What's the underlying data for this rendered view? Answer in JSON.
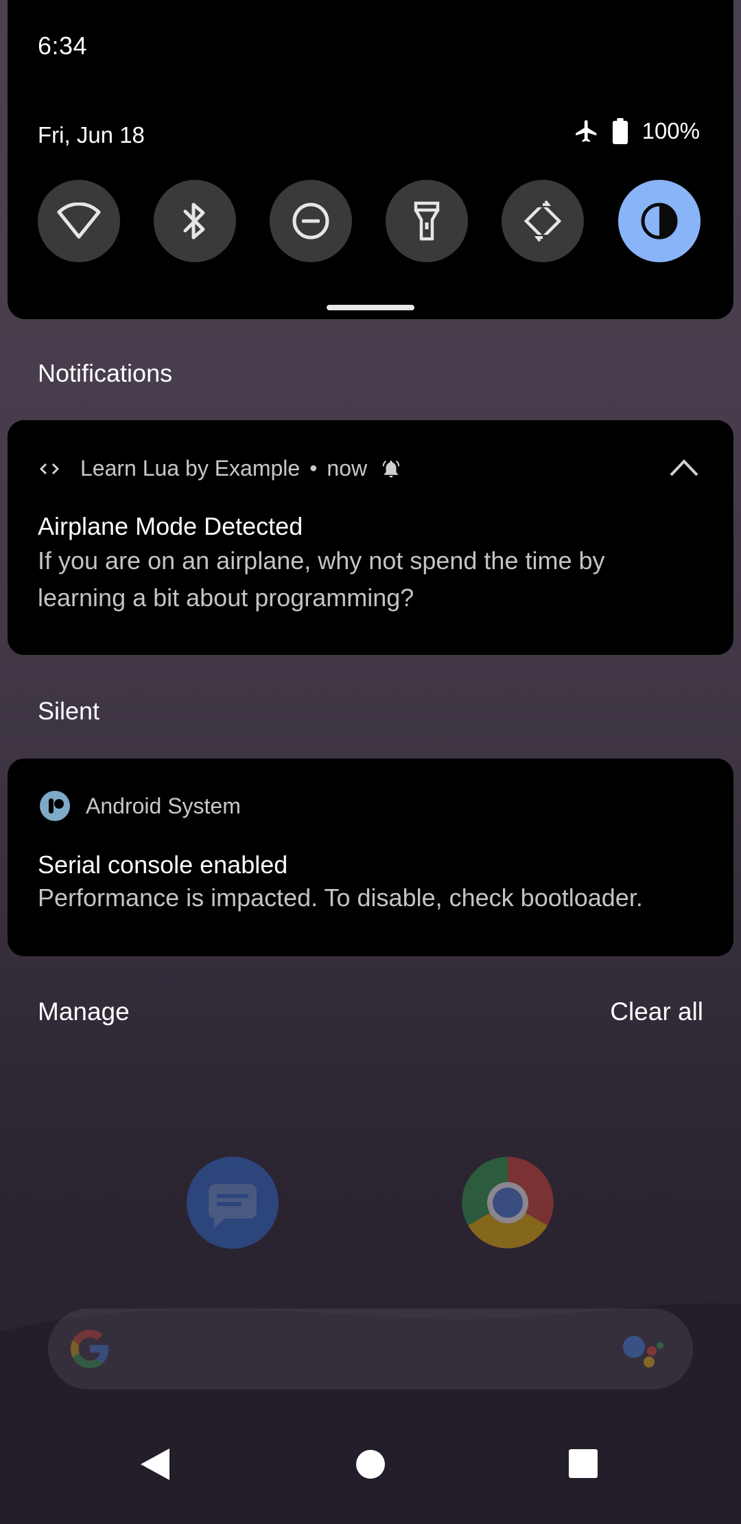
{
  "status_bar": {
    "time": "6:34",
    "battery": "100%"
  },
  "quick_settings": {
    "date": "Fri, Jun 18",
    "tiles": [
      {
        "name": "wifi",
        "icon": "wifi-icon",
        "active": false
      },
      {
        "name": "bluetooth",
        "icon": "bluetooth-icon",
        "active": false
      },
      {
        "name": "do-not-disturb",
        "icon": "do-not-disturb-icon",
        "active": false
      },
      {
        "name": "flashlight",
        "icon": "flashlight-icon",
        "active": false
      },
      {
        "name": "auto-rotate",
        "icon": "rotate-icon",
        "active": false
      },
      {
        "name": "dark-theme",
        "icon": "dark-theme-icon",
        "active": true
      }
    ],
    "active_color": "#8ab4f8"
  },
  "notifications": {
    "section_label": "Notifications",
    "items": [
      {
        "app": "Learn Lua by Example",
        "separator": "•",
        "time": "now",
        "title": "Airplane Mode Detected",
        "body": "If you are on an airplane, why not spend the time by learning a bit about programming?"
      }
    ]
  },
  "silent": {
    "section_label": "Silent",
    "items": [
      {
        "app": "Android System",
        "title": "Serial console enabled",
        "body": "Performance is impacted. To disable, check bootloader."
      }
    ]
  },
  "footer": {
    "manage": "Manage",
    "clear_all": "Clear all"
  }
}
